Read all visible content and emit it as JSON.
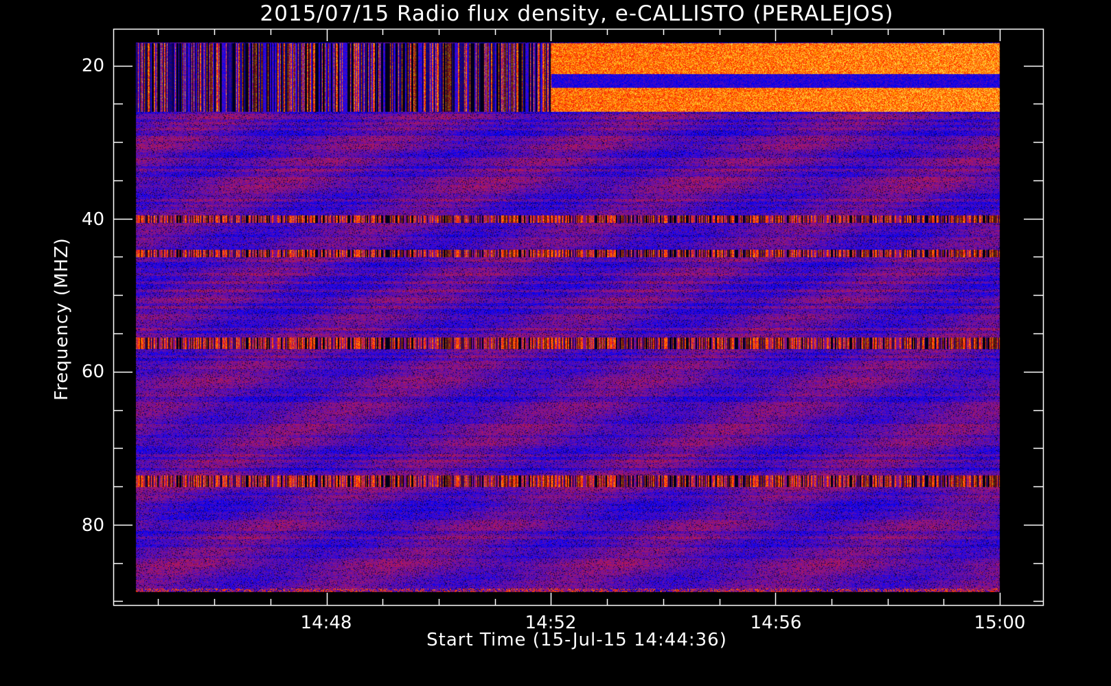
{
  "chart_data": {
    "type": "heatmap",
    "title": "2015/07/15  Radio flux density, e-CALLISTO (PERALEJOS)",
    "xlabel": "Start Time (15-Jul-15 14:44:36)",
    "ylabel": "Frequency (MHZ)",
    "x_ticks": [
      "14:48",
      "14:52",
      "14:56",
      "15:00"
    ],
    "y_ticks": [
      "20",
      "40",
      "60",
      "80"
    ],
    "x_range_minutes_after_1444": [
      0.2,
      16.77
    ],
    "data_time_range_minutes_after_1444": [
      0.6,
      16.0
    ],
    "y_range_mhz": [
      15.2,
      90.5
    ],
    "data_freq_range_mhz": [
      17,
      88.8
    ],
    "y_inverted": true,
    "colormap": [
      "#000000",
      "#0000ff",
      "#8a1a8a",
      "#ff2000",
      "#ffa000",
      "#ffff80"
    ],
    "features": [
      {
        "band_mhz": [
          17,
          26
        ],
        "note": "strong interference bands, intensifying after 14:52"
      },
      {
        "band_mhz": [
          39.5,
          40.5
        ],
        "note": "bright interference line"
      },
      {
        "band_mhz": [
          44,
          45
        ],
        "note": "interference line"
      },
      {
        "band_mhz": [
          55.5,
          57
        ],
        "note": "interference line"
      },
      {
        "band_mhz": [
          73.5,
          75
        ],
        "note": "interference line"
      }
    ]
  }
}
